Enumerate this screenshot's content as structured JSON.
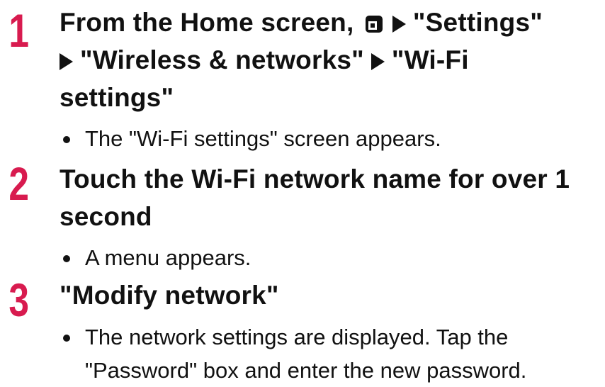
{
  "colors": {
    "step_number": "#d81b4f",
    "text": "#111111",
    "background": "#ffffff"
  },
  "steps": [
    {
      "number": "1",
      "title_parts": [
        "From the Home screen,",
        "\"Settings\"",
        "\"Wireless & networks\"",
        "\"Wi-Fi",
        "settings\""
      ],
      "icons": [
        "menu-key-icon",
        "arrow-icon"
      ],
      "bullet": "The \"Wi-Fi settings\" screen appears."
    },
    {
      "number": "2",
      "title_lines": [
        "Touch the Wi-Fi network name for over 1",
        "second"
      ],
      "bullet": "A menu appears."
    },
    {
      "number": "3",
      "title": "\"Modify network\"",
      "bullet_lines": [
        "The network settings are displayed. Tap the",
        "\"Password\" box and enter the new password."
      ]
    }
  ]
}
